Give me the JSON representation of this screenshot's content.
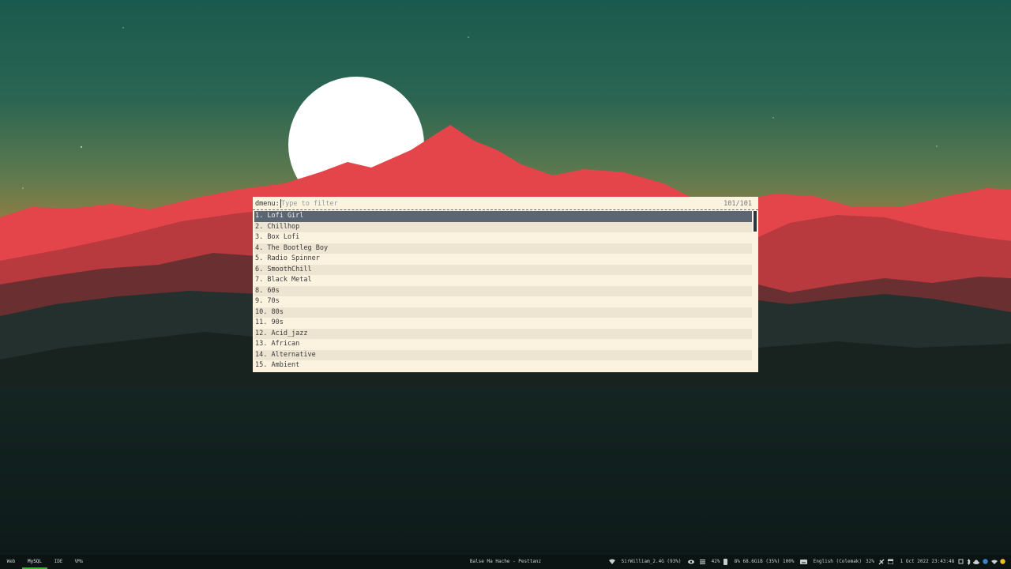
{
  "dmenu": {
    "prompt": "dmenu:",
    "placeholder": "Type to filter",
    "counter": "101/101",
    "items": [
      "1. Lofi Girl",
      "2. Chillhop",
      "3. Box Lofi",
      "4. The Bootleg Boy",
      "5. Radio Spinner",
      "6. SmoothChill",
      "7. Black Metal",
      "8. 60s",
      "9. 70s",
      "10. 80s",
      "11. 90s",
      "12. Acid_jazz",
      "13. African",
      "14. Alternative",
      "15. Ambient"
    ],
    "selected_index": 0
  },
  "bar": {
    "workspaces": [
      "Web",
      "MySQL",
      "IDE",
      "VMs"
    ],
    "active_workspace": "MySQL",
    "window_title": "Balse Ma Hache - Pesttanz",
    "wifi": "SirWilliam_2.4G (93%)",
    "cpu": "42%",
    "memory": "8% 68.6GiB (35%) 100%",
    "keyboard": "English (Colemak)",
    "brightness": "32%",
    "datetime": "1 Oct 2022 23:43:48",
    "accent_color": "#3fae3a"
  },
  "icons": {
    "wifi": "wifi-icon",
    "eye": "eye-icon",
    "cpu": "cpu-icon",
    "memory": "memory-icon",
    "keyboard": "keyboard-icon",
    "brightness": "brightness-icon",
    "calendar": "calendar-icon",
    "tray": [
      "network-tray-icon",
      "bluetooth-tray-icon",
      "cloud-tray-icon",
      "globe-tray-icon",
      "wifi-tray-icon",
      "sun-tray-icon"
    ]
  }
}
